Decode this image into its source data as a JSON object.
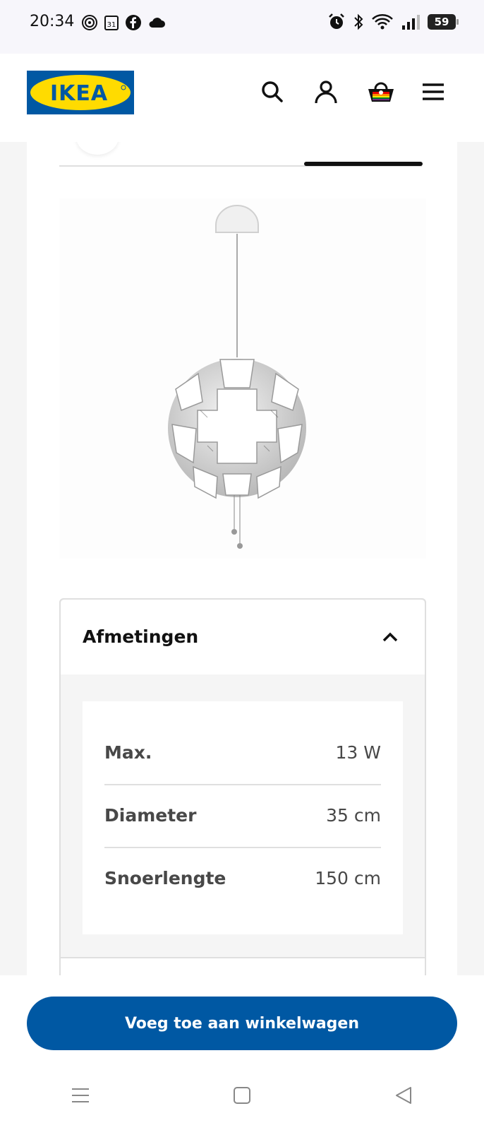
{
  "status_bar": {
    "time": "20:34",
    "calendar_day": "31",
    "battery": "59"
  },
  "header": {
    "logo_text": "IKEA",
    "icons": [
      "search-icon",
      "account-icon",
      "basket-icon",
      "menu-icon"
    ]
  },
  "product": {
    "image": "pendant-lamp-image"
  },
  "accordion": {
    "title": "Afmetingen",
    "expanded": true,
    "rows": [
      {
        "label": "Max.",
        "value": "13 W"
      },
      {
        "label": "Diameter",
        "value": "35 cm"
      },
      {
        "label": "Snoerlengte",
        "value": "150 cm"
      }
    ]
  },
  "cta": {
    "label": "Voeg toe aan winkelwagen"
  },
  "colors": {
    "ikea_blue": "#0058a3",
    "ikea_yellow": "#ffdb00"
  },
  "nav_bar": {
    "icons": [
      "recents-icon",
      "home-icon",
      "back-icon"
    ]
  }
}
